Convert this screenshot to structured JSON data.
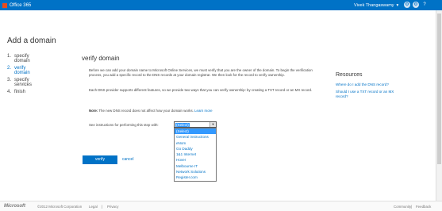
{
  "header": {
    "app_name": "Office 365",
    "user_name": "Vivek Thangaswamy",
    "user_caret": "▾",
    "icons": [
      "settings-icon",
      "gear-icon",
      "help-icon"
    ],
    "help_glyph": "?",
    "accent": "#0072c6",
    "logo_color": "#e74c1c"
  },
  "page": {
    "title": "Add a domain"
  },
  "steps": [
    {
      "num": "1.",
      "label": "specify domain",
      "active": false
    },
    {
      "num": "2.",
      "label": "verify domain",
      "active": true
    },
    {
      "num": "3.",
      "label": "specify services",
      "active": false
    },
    {
      "num": "4.",
      "label": "finish",
      "active": false
    }
  ],
  "main": {
    "section_title": "verify domain",
    "paragraph1": "Before we can add your domain name to Microsoft Online Services, we must verify that you are the owner of the domain. To begin the verification process, you add a specific record to the DNS records at your domain registrar. We then look for the record to verify ownership.",
    "paragraph2": "Each DNS provider supports different features, so we provide two ways that you can verify ownership: by creating a TXT record or an MX record.",
    "note_label": "Note:",
    "note_text": "The new DNS record does not affect how your domain works.",
    "note_link": "Learn more",
    "instructions_label": "See instructions for performing this step with:",
    "select_value": "(Select)",
    "select_arrow": "▼",
    "dropdown_options": [
      "(Select)",
      "General instructions",
      "eNom",
      "Go Daddy",
      "1&1 Internet",
      "Hover",
      "Melbourne IT",
      "Network Solutions",
      "Register.com"
    ],
    "verify_label": "verify",
    "cancel_label": "cancel"
  },
  "resources": {
    "title": "Resources",
    "links": [
      "Where do I add the DNS record?",
      "Should I use a TXT record or an MX record?"
    ]
  },
  "footer": {
    "logo": "Microsoft",
    "copyright": "©2012 Microsoft Corporation",
    "legal": "Legal",
    "separator": "|",
    "privacy": "Privacy",
    "community": "Community",
    "feedback": "Feedback"
  }
}
